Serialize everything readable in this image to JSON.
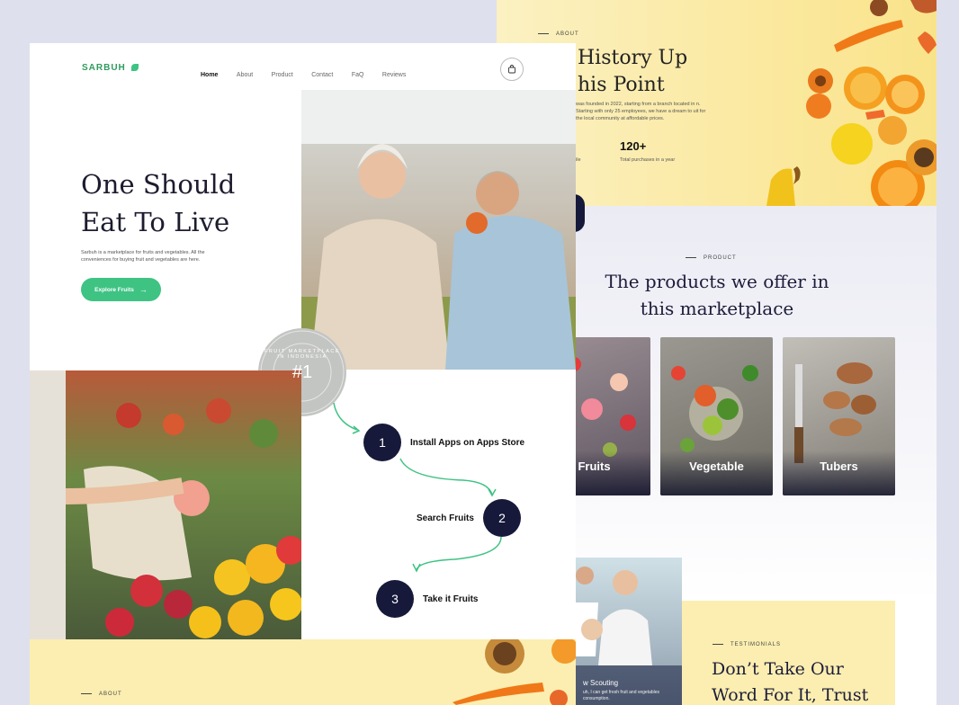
{
  "back": {
    "about": {
      "label": "ABOUT",
      "heading_line1": "History Up",
      "heading_line2": "his Point",
      "body": "was founded in 2022, starting from a branch located in n. Starting with only 25 employees, we have a dream to uit for the local community at affordable prices.",
      "stat_value": "120+",
      "stat_caption": "Total purchases in a year",
      "stat_left_caption": "ile"
    },
    "product": {
      "label": "PRODUCT",
      "heading_line1": "The products we offer in",
      "heading_line2": "this marketplace",
      "cards": [
        {
          "label": "Fruits"
        },
        {
          "label": "Vegetable"
        },
        {
          "label": "Tubers"
        }
      ]
    },
    "testimonials": {
      "label": "TESTIMONIALS",
      "heading_line1": "Don’t Take Our",
      "heading_line2": "Word For It, Trust",
      "photo_caption_title": "w Scouting",
      "photo_caption_body": "uh, I can get fresh fruit and vegetables consumption."
    }
  },
  "front": {
    "nav": {
      "brand": "SARBUH",
      "links": [
        "Home",
        "About",
        "Product",
        "Contact",
        "FaQ",
        "Reviews"
      ]
    },
    "hero": {
      "title_line1": "One Should",
      "title_line2": "Eat To Live",
      "description": "Sarbuh is a marketplace for fruits and vegetables. All the conveniences for buying fruit and vegetables are here.",
      "cta_label": "Explore Fruits"
    },
    "badge": {
      "number": "#1",
      "ring_text": "FRUIT MARKETPLACE IN INDONESIA"
    },
    "steps": [
      {
        "number": "1",
        "label": "Install Apps on Apps Store"
      },
      {
        "number": "2",
        "label": "Search Fruits"
      },
      {
        "number": "3",
        "label": "Take it Fruits"
      }
    ],
    "about_strip": {
      "label": "ABOUT"
    }
  },
  "colors": {
    "brand_green": "#3ec383",
    "navy": "#16193a",
    "cream": "#fbeeb0",
    "background": "#dfe0ee"
  }
}
